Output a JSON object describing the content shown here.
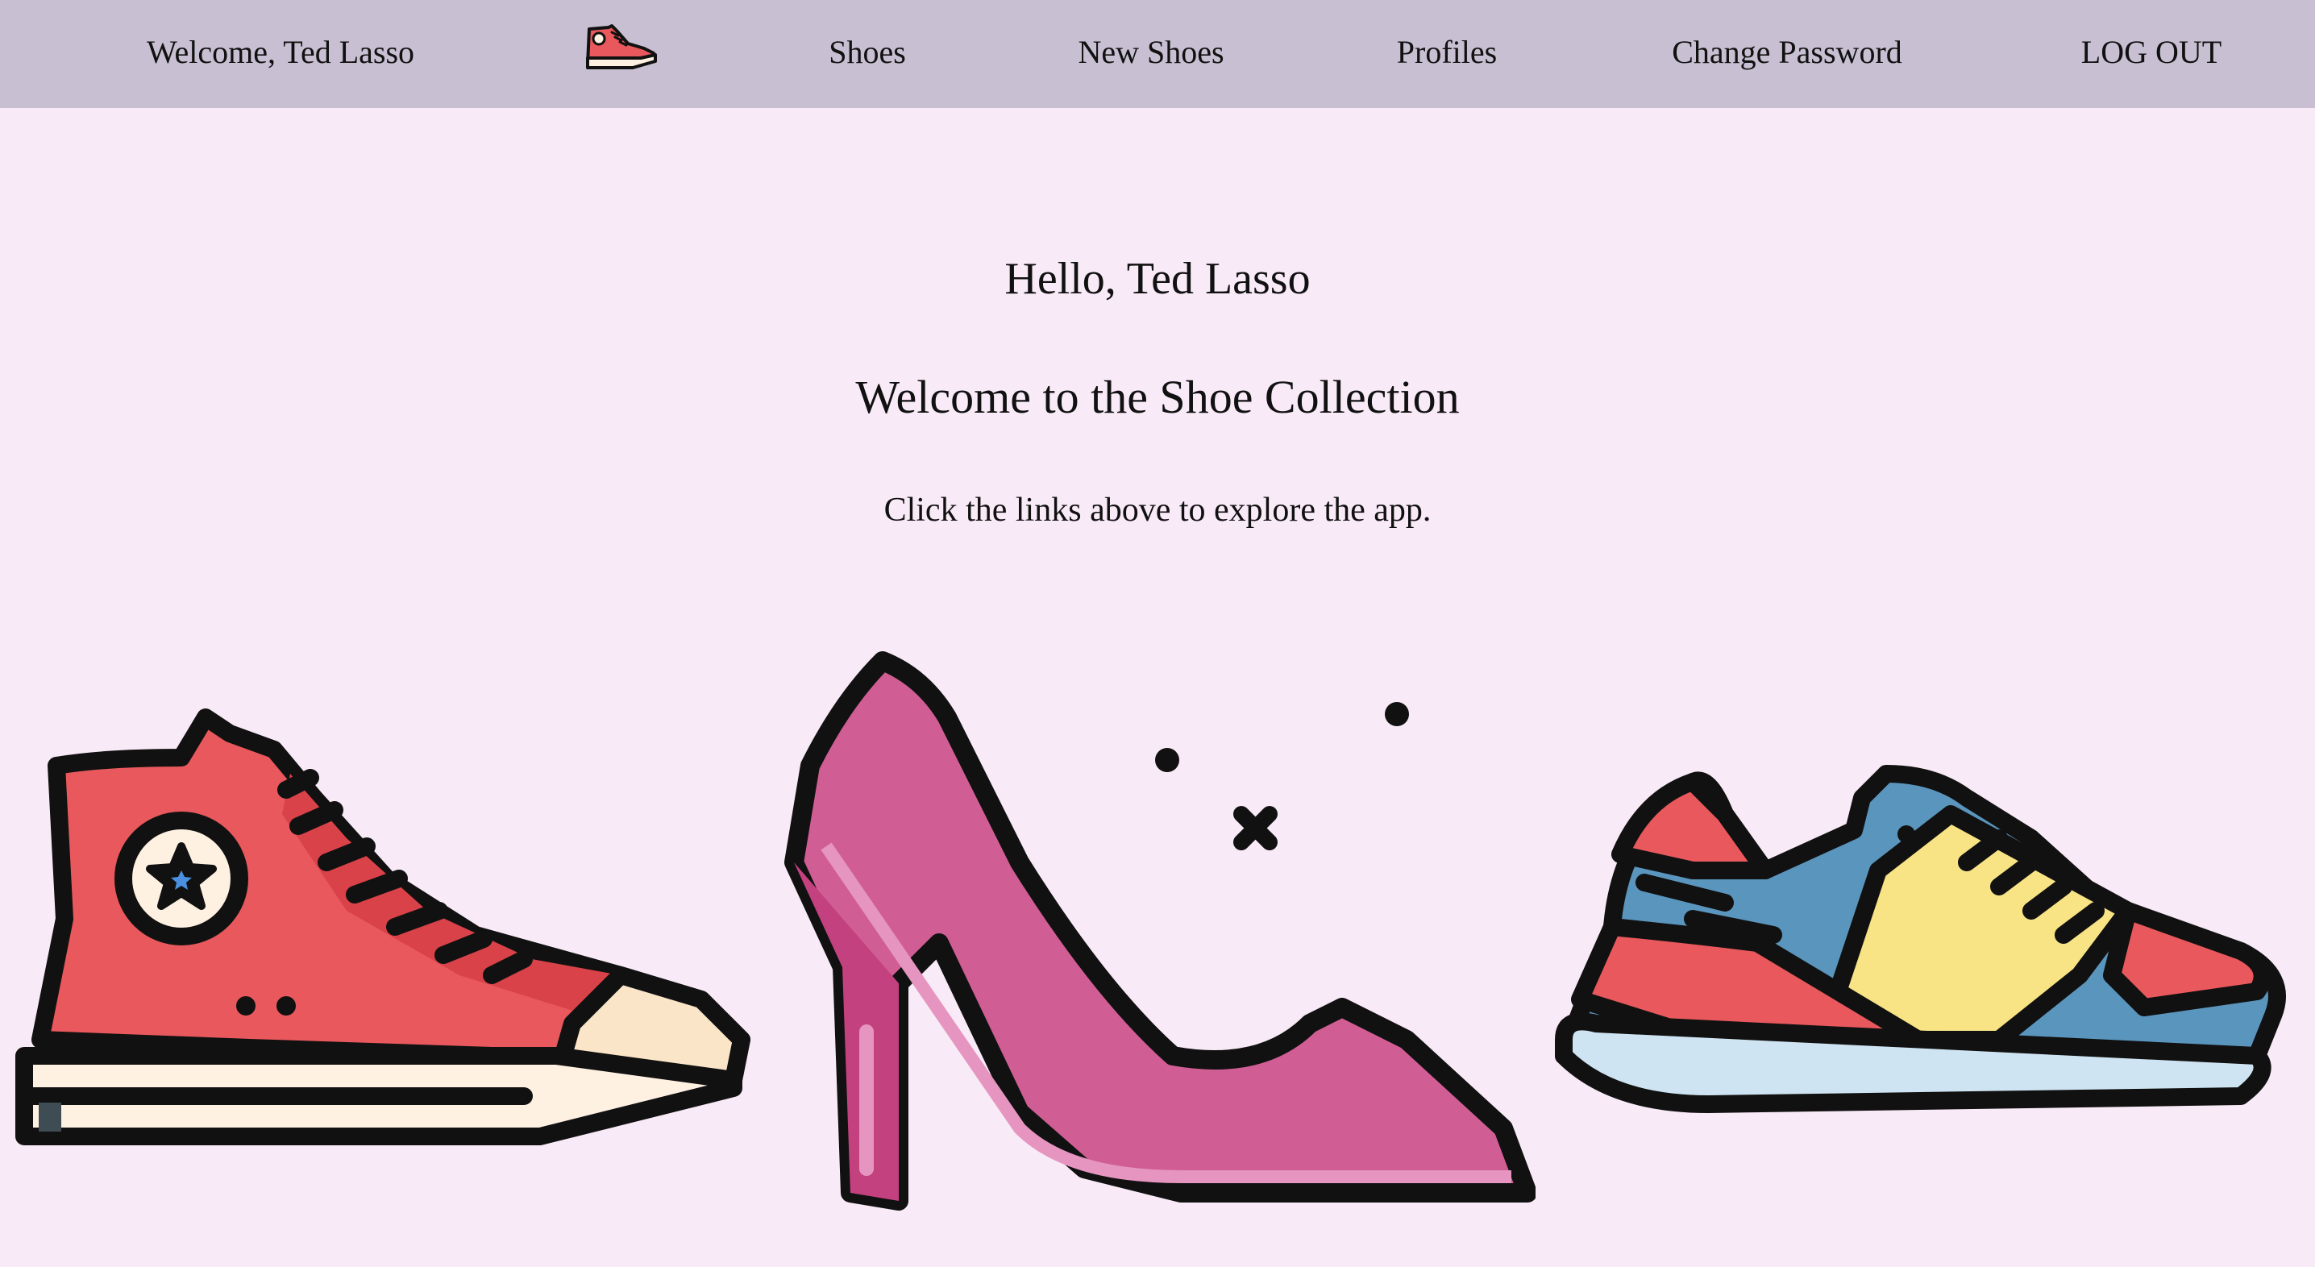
{
  "nav": {
    "welcome": "Welcome, Ted Lasso",
    "logo_icon": "sneaker-icon",
    "links": [
      "Shoes",
      "New Shoes",
      "Profiles",
      "Change Password",
      "LOG OUT"
    ]
  },
  "main": {
    "greeting": "Hello, Ted Lasso",
    "title": "Welcome to the Shoe Collection",
    "subtitle": "Click the links above to explore the app."
  },
  "illustrations": [
    "high-top-sneaker-icon",
    "high-heel-icon",
    "running-shoe-icon"
  ],
  "colors": {
    "background": "#f9eaf7",
    "navbar": "#c8c0d2",
    "sneaker_red": "#e8585c",
    "heel_pink": "#d05e94",
    "runner_blue": "#5a95bd",
    "runner_yellow": "#f8e485"
  }
}
